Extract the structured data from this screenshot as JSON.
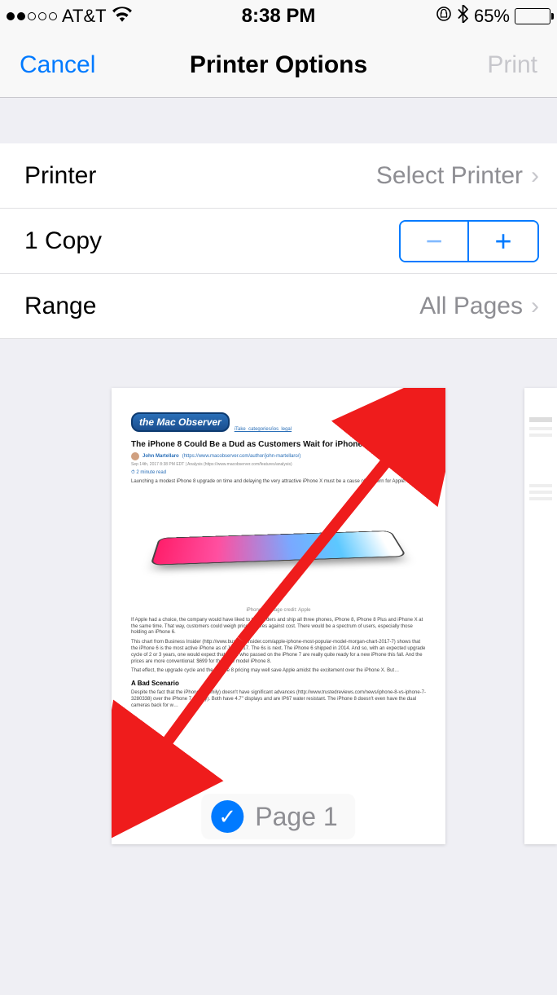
{
  "status_bar": {
    "carrier": "AT&T",
    "time": "8:38 PM",
    "battery_percent": "65%"
  },
  "nav": {
    "cancel": "Cancel",
    "title": "Printer Options",
    "print": "Print"
  },
  "rows": {
    "printer_label": "Printer",
    "printer_value": "Select Printer",
    "copies_label": "1 Copy",
    "range_label": "Range",
    "range_value": "All Pages"
  },
  "preview": {
    "page_badge": "Page 1",
    "article": {
      "logo_text": "the Mac Observer",
      "top_link": "iTake_categories/ios_legal",
      "headline": "The iPhone 8 Could Be a Dud as Customers Wait for iPhone X",
      "author": "John Martellaro",
      "author_url": "(https://www.macobserver.com/author/john-martellaro/)",
      "date_line": "Sep 14th, 2017 8:38 PM EDT | Analysis (https://www.macobserver.com/features/analysis)",
      "read_time": "2 minute read",
      "lede": "Launching a modest iPhone 8 upgrade on time and delaying the very attractive iPhone X must be a cause of concern for Apple.",
      "caption": "iPhone X. Image credit: Apple",
      "p1": "If Apple had a choice, the company would have liked to take orders and ship all three phones, iPhone 8, iPhone 8 Plus and iPhone X at the same time. That way, customers could weigh price features against cost. There would be a spectrum of users, especially those holding an iPhone 6.",
      "p2": "This chart from Business Insider (http://www.businessinsider.com/apple-iphone-most-popular-model-morgan-chart-2017-7) shows that the iPhone 6 is the most active iPhone as of July 2017. The 6s is next. The iPhone 6 shipped in 2014. And so, with an expected upgrade cycle of 2 or 3 years, one would expect that those who passed on the iPhone 7 are really quite ready for a new iPhone this fall. And the prices are more conventional: $699 for the base model iPhone 8.",
      "p3": "That effect, the upgrade cycle and the iPhone 8 pricing may well save Apple amidst the excitement over the iPhone X. But…",
      "subhead": "A Bad Scenario",
      "p4": "Despite the fact that the iPhone 8 (family) doesn't have significant advances (http://www.trustedreviews.com/news/iphone-8-vs-iphone-7-3280338) over the iPhone 7 (family). Both have 4.7\" displays and are IP67 water resistant. The iPhone 8 doesn't even have the dual cameras back for w…"
    }
  }
}
